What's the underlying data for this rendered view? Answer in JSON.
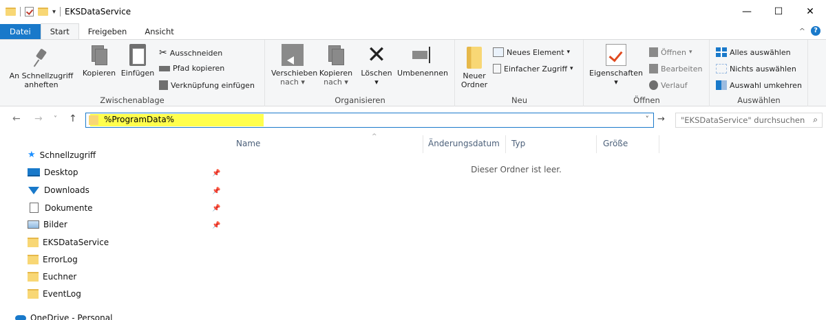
{
  "window": {
    "title": "EKSDataService",
    "controls": {
      "minimize": "—",
      "maximize": "☐",
      "close": "✕"
    }
  },
  "quick_access_toolbar": {
    "dropdown": "▾"
  },
  "ribbon_tabs": [
    "Datei",
    "Start",
    "Freigeben",
    "Ansicht"
  ],
  "ribbon": {
    "clipboard": {
      "label": "Zwischenablage",
      "pin_line1": "An Schnellzugriff",
      "pin_line2": "anheften",
      "copy": "Kopieren",
      "paste": "Einfügen",
      "cut": "Ausschneiden",
      "copy_path": "Pfad kopieren",
      "paste_shortcut": "Verknüpfung einfügen"
    },
    "organize": {
      "label": "Organisieren",
      "move_line1": "Verschieben",
      "move_line2": "nach",
      "copy_line1": "Kopieren",
      "copy_line2": "nach",
      "delete": "Löschen",
      "rename": "Umbenennen"
    },
    "new": {
      "label": "Neu",
      "folder_line1": "Neuer",
      "folder_line2": "Ordner",
      "new_item": "Neues Element",
      "easy_access": "Einfacher Zugriff"
    },
    "open": {
      "label": "Öffnen",
      "properties": "Eigenschaften",
      "open": "Öffnen",
      "edit": "Bearbeiten",
      "history": "Verlauf"
    },
    "select": {
      "label": "Auswählen",
      "select_all": "Alles auswählen",
      "select_none": "Nichts auswählen",
      "invert": "Auswahl umkehren"
    }
  },
  "address_bar": {
    "value": "%ProgramData%",
    "search_placeholder": "\"EKSDataService\" durchsuchen"
  },
  "nav_pane": {
    "quick_access": "Schnellzugriff",
    "items": [
      {
        "label": "Desktop",
        "icon": "desktop-icon",
        "pinned": true
      },
      {
        "label": "Downloads",
        "icon": "download-icon",
        "pinned": true
      },
      {
        "label": "Dokumente",
        "icon": "document-icon",
        "pinned": true
      },
      {
        "label": "Bilder",
        "icon": "pictures-icon",
        "pinned": true
      },
      {
        "label": "EKSDataService",
        "icon": "folder-icon",
        "pinned": false
      },
      {
        "label": "ErrorLog",
        "icon": "folder-icon",
        "pinned": false
      },
      {
        "label": "Euchner",
        "icon": "folder-icon",
        "pinned": false
      },
      {
        "label": "EventLog",
        "icon": "folder-icon",
        "pinned": false
      }
    ],
    "onedrive": "OneDrive - Personal"
  },
  "columns": [
    "Name",
    "Änderungsdatum",
    "Typ",
    "Größe"
  ],
  "empty_message": "Dieser Ordner ist leer.",
  "colors": {
    "accent": "#1979ca",
    "highlight": "#ffff4d",
    "folder": "#f8d775"
  }
}
